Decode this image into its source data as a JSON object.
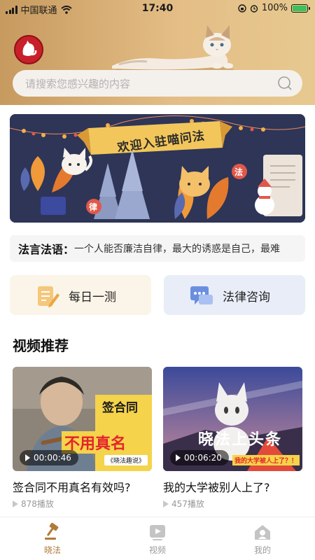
{
  "status_bar": {
    "carrier": "中国联通",
    "time": "17:40",
    "battery": "100%"
  },
  "search": {
    "placeholder": "请搜索您感兴趣的内容"
  },
  "banner": {
    "title": "欢迎入驻喵问法",
    "badge_1": "律",
    "badge_2": "法"
  },
  "quote": {
    "label": "法言法语：",
    "text": "一个人能否廉洁自律，最大的诱惑是自己，最难"
  },
  "quick_actions": [
    {
      "label": "每日一测",
      "icon": "notepad-pencil-icon"
    },
    {
      "label": "法律咨询",
      "icon": "chat-bubbles-icon"
    }
  ],
  "section": {
    "title": "视频推荐"
  },
  "videos": [
    {
      "duration": "00:00:46",
      "title": "签合同不用真名有效吗?",
      "views": "878播放",
      "overlay_line_1": "签合同",
      "overlay_line_2": "不用真名",
      "overlay_tag": "《晓法趣说》"
    },
    {
      "duration": "00:06:20",
      "title": "我的大学被别人上了?",
      "views": "457播放",
      "overlay_text": "晓法上头条",
      "overlay_caption": "我的大学被人上了？！"
    }
  ],
  "tabs": [
    {
      "label": "晓法",
      "icon": "gavel-icon",
      "active": true
    },
    {
      "label": "视频",
      "icon": "video-play-icon",
      "active": false
    },
    {
      "label": "我的",
      "icon": "home-user-icon",
      "active": false
    }
  ],
  "colors": {
    "header_gold": "#d9ad6e",
    "accent_brown": "#b07a3a",
    "banner_navy": "#2e3557"
  }
}
